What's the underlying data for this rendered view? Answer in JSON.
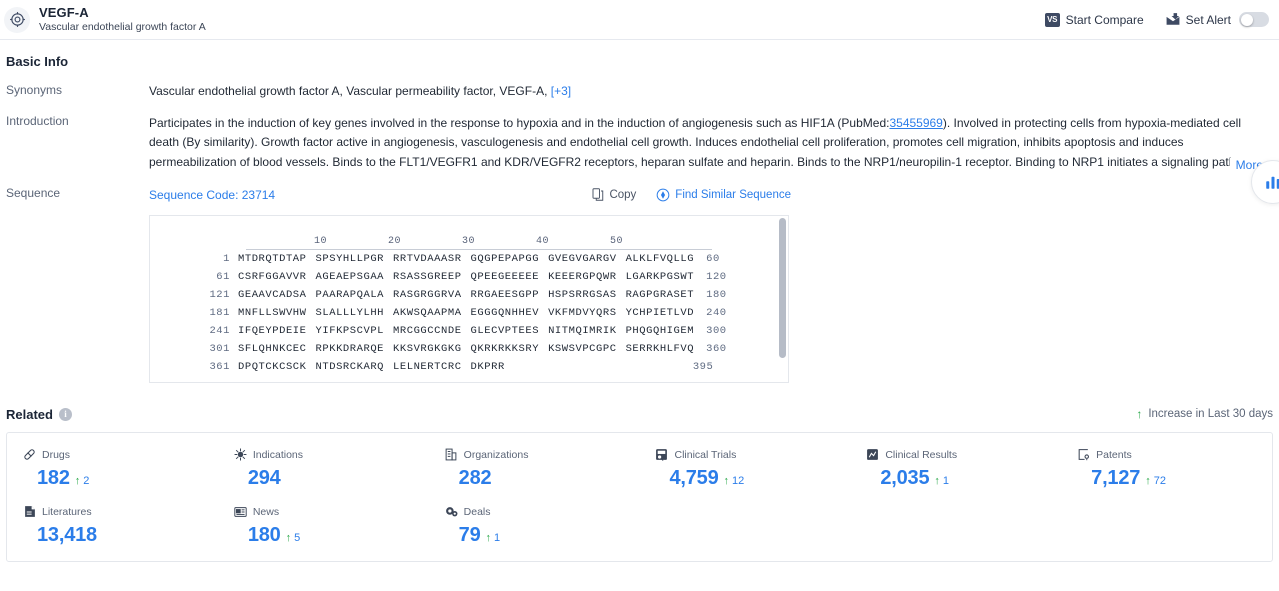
{
  "header": {
    "logo_icon": "target-crosshair-icon",
    "title": "VEGF-A",
    "subtitle": "Vascular endothelial growth factor A",
    "start_compare": {
      "label": "Start Compare",
      "badge": "VS",
      "icon": "vs-badge-icon"
    },
    "set_alert": {
      "label": "Set Alert",
      "icon": "alert-envelope-icon",
      "toggle_on": false
    }
  },
  "basic_info": {
    "section_title": "Basic Info",
    "synonyms": {
      "label": "Synonyms",
      "values": "Vascular endothelial growth factor A,  Vascular permeability factor,  VEGF-A,",
      "more_count": "[+3]"
    },
    "introduction": {
      "label": "Introduction",
      "text_before_link": "Participates in the induction of key genes involved in the response to hypoxia and in the induction of angiogenesis such as HIF1A (PubMed:",
      "pubmed_id": "35455969",
      "text_after_link": "). Involved in protecting cells from hypoxia-mediated cell death (By similarity). Growth factor active in angiogenesis, vasculogenesis and endothelial cell growth. Induces endothelial cell proliferation, promotes cell migration, inhibits apoptosis and induces permeabilization of blood vessels. Binds to the FLT1/VEGFR1 and KDR/VEGFR2 receptors, heparan sulfate and heparin. Binds to the NRP1/neuropilin-1 receptor. Binding to NRP1 initiates a signaling pathway needed for motor neuron axon guidance and cell body migr",
      "more_label": "More",
      "more_icon": "chevron-double-down-icon"
    },
    "sequence": {
      "label": "Sequence",
      "code_label": "Sequence Code: 23714",
      "copy_label": "Copy",
      "copy_icon": "copy-icon",
      "find_similar_label": "Find Similar Sequence",
      "find_similar_icon": "find-similar-icon",
      "ruler_ticks": [
        "10",
        "20",
        "30",
        "40",
        "50"
      ],
      "rows": [
        {
          "start": "1",
          "chunks": [
            "MTDRQTDTAP",
            "SPSYHLLPGR",
            "RRTVDAAASR",
            "GQGPEPAPGG",
            "GVEGVGARGV",
            "ALKLFVQLLG"
          ],
          "end": "60"
        },
        {
          "start": "61",
          "chunks": [
            "CSRFGGAVVR",
            "AGEAEPSGAA",
            "RSASSGREEP",
            "QPEEGEEEEE",
            "KEEERGPQWR",
            "LGARKPGSWT"
          ],
          "end": "120"
        },
        {
          "start": "121",
          "chunks": [
            "GEAAVCADSA",
            "PAARAPQALA",
            "RASGRGGRVA",
            "RRGAEESGPP",
            "HSPSRRGSAS",
            "RAGPGRASET"
          ],
          "end": "180"
        },
        {
          "start": "181",
          "chunks": [
            "MNFLLSWVHW",
            "SLALLLYLHH",
            "AKWSQAAPMA",
            "EGGGQNHHEV",
            "VKFMDVYQRS",
            "YCHPIETLVD"
          ],
          "end": "240"
        },
        {
          "start": "241",
          "chunks": [
            "IFQEYPDEIE",
            "YIFKPSCVPL",
            "MRCGGCCNDE",
            "GLECVPTEES",
            "NITMQIMRIK",
            "PHQGQHIGEM"
          ],
          "end": "300"
        },
        {
          "start": "301",
          "chunks": [
            "SFLQHNKCEC",
            "RPKKDRARQE",
            "KKSVRGKGKG",
            "QKRKRKKSRY",
            "KSWSVPCGPC",
            "SERRKHLFVQ"
          ],
          "end": "360"
        },
        {
          "start": "361",
          "chunks": [
            "DPQTCKCSCK",
            "NTDSRCKARQ",
            "LELNERTCRC",
            "DKPRR"
          ],
          "end": "395"
        }
      ]
    }
  },
  "related": {
    "title": "Related",
    "info_icon": "info-icon",
    "legend": {
      "arrow": "↑",
      "label": "Increase in Last 30 days"
    },
    "cards": [
      {
        "label": "Drugs",
        "icon": "pill-icon",
        "value": "182",
        "delta": "2"
      },
      {
        "label": "Indications",
        "icon": "virus-icon",
        "value": "294",
        "delta": ""
      },
      {
        "label": "Organizations",
        "icon": "building-icon",
        "value": "282",
        "delta": ""
      },
      {
        "label": "Clinical Trials",
        "icon": "clinical-trial-icon",
        "value": "4,759",
        "delta": "12"
      },
      {
        "label": "Clinical Results",
        "icon": "clinical-result-icon",
        "value": "2,035",
        "delta": "1"
      },
      {
        "label": "Patents",
        "icon": "patent-icon",
        "value": "7,127",
        "delta": "72"
      },
      {
        "label": "Literatures",
        "icon": "book-icon",
        "value": "13,418",
        "delta": ""
      },
      {
        "label": "News",
        "icon": "news-icon",
        "value": "180",
        "delta": "5"
      },
      {
        "label": "Deals",
        "icon": "deals-icon",
        "value": "79",
        "delta": "1"
      }
    ]
  },
  "float_widget": {
    "icon": "chart-bar-icon"
  },
  "colors": {
    "accent_blue": "#2b7de9",
    "increase_green": "#2aa84a",
    "text_dark": "#1f2733",
    "text_muted": "#5b6577",
    "border": "#e4e7ec"
  }
}
